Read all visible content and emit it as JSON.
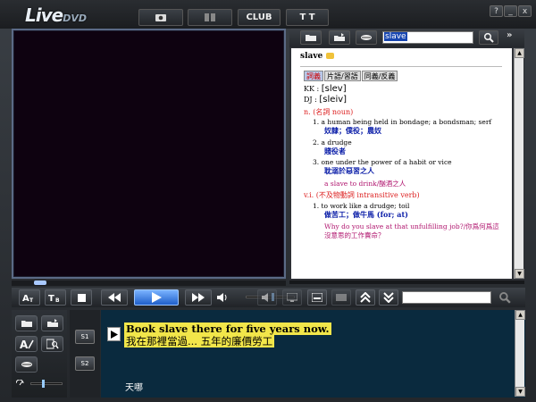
{
  "app": {
    "logo_main": "Live",
    "logo_sub": "DVD"
  },
  "topbar": {
    "club_label": "CLUB",
    "text_size_label": "T T"
  },
  "window": {
    "help": "?",
    "minimize": "_",
    "close": "x"
  },
  "dict": {
    "search_value": "slave",
    "expand_label": "»",
    "headword": "slave",
    "tabs": [
      "詞義",
      "片語/習語",
      "同義/反義"
    ],
    "kk_label": "KK :",
    "kk": "[slev]",
    "dj_label": "DJ :",
    "dj": "[sleiv]",
    "pos_noun": "n. (名詞 noun)",
    "noun_defs": [
      {
        "num": "1.",
        "en": "a human being held in bondage; a bondsman; serf",
        "zh": "奴隸；僕役；農奴"
      },
      {
        "num": "2.",
        "en": "a drudge",
        "zh": "賤役者"
      },
      {
        "num": "3.",
        "en": "one under the power of a habit or vice",
        "zh": "耽溺於惡習之人"
      }
    ],
    "noun_example": "a slave to drink/酗酒之人",
    "pos_verb": "v.i. (不及物動詞 intransitive verb)",
    "verb_defs": [
      {
        "num": "1.",
        "en": "to work like a drudge; toil",
        "zh": "做苦工；做牛馬 (for; at)"
      }
    ],
    "verb_example": "Why do you slave at that unfulfilling job?/你爲何爲這沒意思的工作賣命？"
  },
  "subtitles": {
    "english": "Book slave there for five years now.",
    "chinese": "我在那裡當過... 五年的廉價勞工",
    "note": "天哪",
    "s1_label": "S1",
    "s2_label": "S2"
  }
}
